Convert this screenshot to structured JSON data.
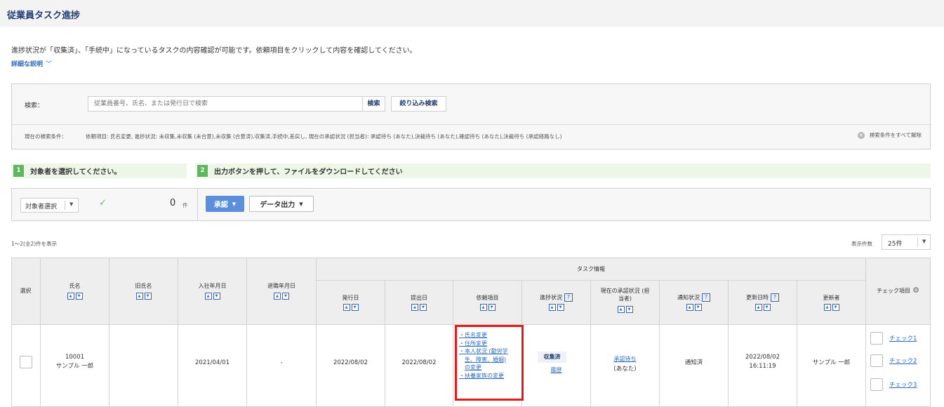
{
  "header": {
    "title": "従業員タスク進捗"
  },
  "intro": {
    "text": "進捗状況が「収集済」、「手続中」になっているタスクの内容確認が可能です。依頼項目をクリックして内容を確認してください。",
    "detail_link": "詳細な説明",
    "detail_icon": "chevron-down-icon"
  },
  "search": {
    "label": "検索：",
    "placeholder": "従業員番号、氏名、または発行日で検索",
    "search_button": "検索",
    "filter_button": "絞り込み検索",
    "condition_label": "現在の検索条件：",
    "condition_text": "依頼項目: 氏名変更, 進捗状況: 未収集,未収集 (未合意),未収集 (合意済),収集済,手続中,差戻し, 現在の承認状況 (担当者): 承認待ち (あなた),決裁待ち (あなた),確認待ち (あなた),決裁待ち (承認経路なし)",
    "clear_all": "検索条件をすべて解除"
  },
  "steps": [
    {
      "num": "1",
      "text": "対象者を選択してください。"
    },
    {
      "num": "2",
      "text": "出力ボタンを押して、ファイルをダウンロードしてください"
    }
  ],
  "actions": {
    "select_target": "対象者選択",
    "selected_count": "0",
    "count_unit": "件",
    "approve_button": "承認",
    "export_button": "データ出力"
  },
  "list": {
    "range": "1～2(全2)件を表示",
    "per_page_label": "表示件数",
    "per_page_value": "25件"
  },
  "table": {
    "headers": {
      "select": "選択",
      "name": "氏名",
      "old_name": "旧氏名",
      "join_date": "入社年月日",
      "leave_date": "退職年月日",
      "task_group": "タスク情報",
      "issue_date": "発行日",
      "submit_date": "提出日",
      "request_items": "依頼項目",
      "progress": "進捗状況",
      "approval_line1": "現在の承認状況 (担",
      "approval_line2": "当者)",
      "notice": "通知状況",
      "updated_at": "更新日時",
      "updated_by": "更新者",
      "check_items": "チェック項目"
    },
    "rows": [
      {
        "emp_no": "10001",
        "name": "サンプル 一郎",
        "old_name": "",
        "join_date": "2021/04/01",
        "leave_date": "-",
        "issue_date": "2022/08/02",
        "submit_date": "2022/08/02",
        "request_items": [
          "・氏名変更",
          "・住所変更",
          "・本人状況 (勤労学",
          "生、障害、婚姻)",
          "の変更",
          "・扶養家族の変更"
        ],
        "progress": "収集済",
        "history": "履歴",
        "approval": "承認待ち",
        "approval_sub": "(あなた)",
        "notice": "通知済",
        "updated_date": "2022/08/02",
        "updated_time": "16:11:19",
        "updated_by": "サンプル 一郎",
        "checks": [
          "チェック1",
          "チェック2",
          "チェック3"
        ]
      }
    ]
  },
  "colors": {
    "title": "#1f3b73",
    "link": "#2a6bc4",
    "step_green": "#5cb85c",
    "approve_blue": "#5b8fdc",
    "highlight_red": "#e21b1b"
  }
}
